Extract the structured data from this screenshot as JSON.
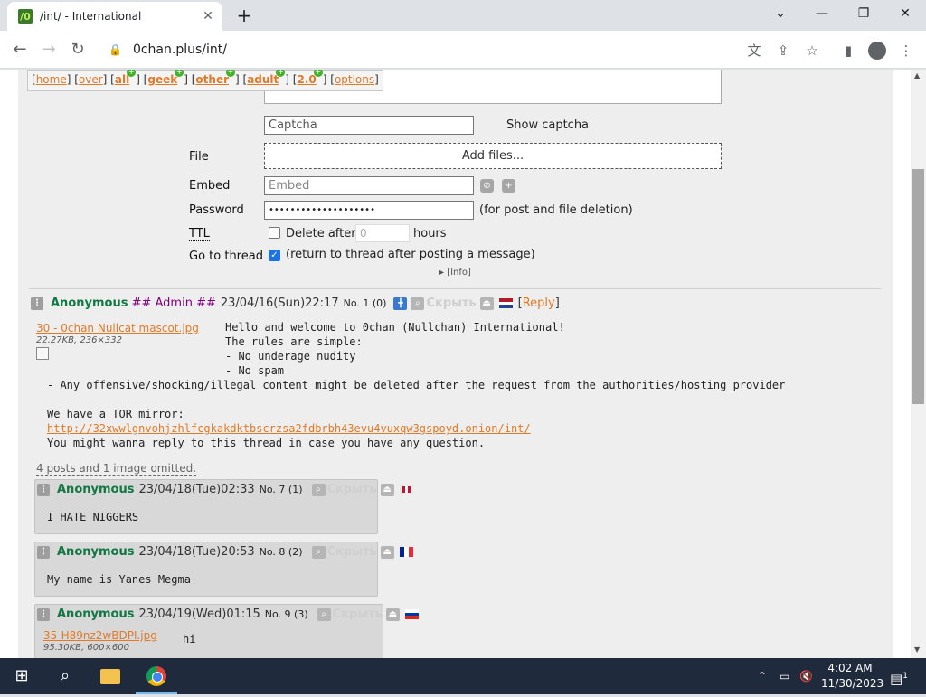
{
  "browser": {
    "tab_title": "/int/ - International",
    "favicon_text": "/0",
    "url": "0chan.plus/int/",
    "tab_close": "✕",
    "new_tab": "+"
  },
  "nav": {
    "items": [
      {
        "label": "home",
        "plus": false
      },
      {
        "label": "over",
        "plus": false
      },
      {
        "label": "all",
        "plus": true
      },
      {
        "label": "geek",
        "plus": true
      },
      {
        "label": "other",
        "plus": true
      },
      {
        "label": "adult",
        "plus": true
      },
      {
        "label": "2.0",
        "plus": true
      },
      {
        "label": "options",
        "plus": false
      }
    ]
  },
  "form": {
    "captcha_placeholder": "Captcha",
    "show_captcha": "Show captcha",
    "file_label": "File",
    "add_files": "Add files...",
    "embed_label": "Embed",
    "embed_placeholder": "Embed",
    "password_label": "Password",
    "password_value": "••••••••••••••••••••",
    "password_note": "(for post and file deletion)",
    "ttl_label": "TTL",
    "delete_after": "Delete after",
    "ttl_value": "0",
    "hours": "hours",
    "goto_label": "Go to thread",
    "goto_note": "(return to thread after posting a message)",
    "info": "[Info]"
  },
  "op": {
    "name": "Anonymous",
    "trip": "## Admin ##",
    "date": "23/04/16(Sun)22:17",
    "no": "No. 1 (0)",
    "hide": "Скрыть",
    "reply_label": "Reply",
    "file_name": "30 - 0chan Nullcat mascot.jpg",
    "file_meta": "22.27KB, 236×332",
    "lines_right": [
      "Hello and welcome to 0chan (Nullchan) International!",
      "The rules are simple:",
      "- No underage nudity",
      "- No spam"
    ],
    "line_wide": "- Any offensive/shocking/illegal content might be deleted after the request from the authorities/hosting provider",
    "tor_intro": "We have a TOR mirror:",
    "tor_link": "http://32xwwlgnvohjzhlfcgkakdktbscrzsa2fdbrbh43evu4vuxqw3gspoyd.onion/int/",
    "last_line": "You might wanna reply to this thread in case you have any question."
  },
  "omitted": "4 posts and 1 image omitted.",
  "replies": [
    {
      "name": "Anonymous",
      "date": "23/04/18(Tue)02:33",
      "no": "No. 7 (1)",
      "hide": "Скрыть",
      "text": "I HATE NIGGERS"
    },
    {
      "name": "Anonymous",
      "date": "23/04/18(Tue)20:53",
      "no": "No. 8 (2)",
      "hide": "Скрыть",
      "text": "My name is Yanes Megma"
    },
    {
      "name": "Anonymous",
      "date": "23/04/19(Wed)01:15",
      "no": "No. 9 (3)",
      "hide": "Скрыть",
      "file_name": "35-H89nz2wBDPI.jpg",
      "file_meta": "95.30KB, 600×600",
      "text": "hi"
    }
  ],
  "taskbar": {
    "time": "4:02 AM",
    "date": "11/30/2023",
    "notification_count": "1"
  },
  "colors": {
    "accent_orange": "#e07a28",
    "name_green": "#117743",
    "trip_purple": "#800080"
  }
}
